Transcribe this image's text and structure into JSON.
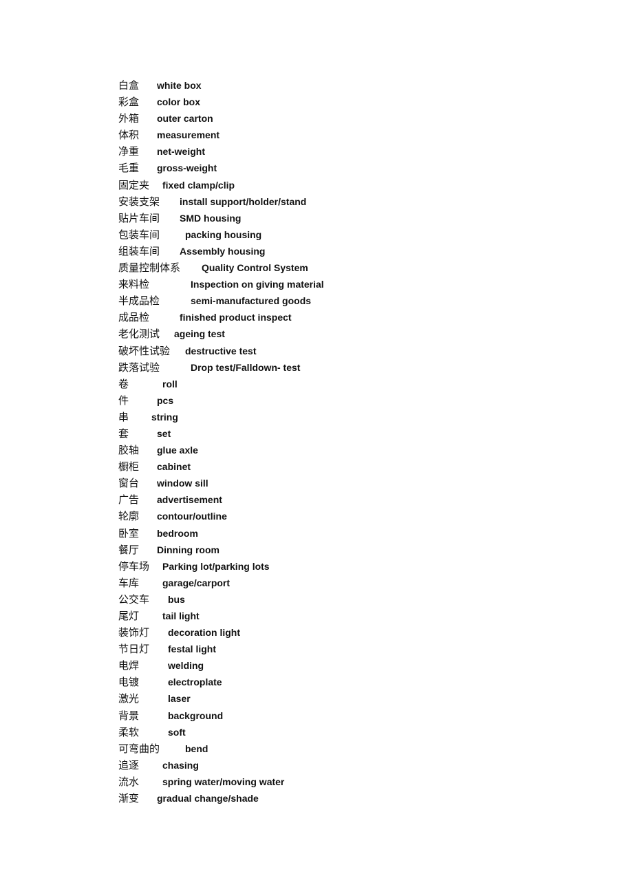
{
  "document": {
    "entries": [
      {
        "zh": "白盒",
        "en": "white box",
        "indent": 56
      },
      {
        "zh": "彩盒",
        "en": "color box",
        "indent": 56
      },
      {
        "zh": "外箱",
        "en": "outer carton",
        "indent": 56
      },
      {
        "zh": "体积",
        "en": "measurement",
        "indent": 56
      },
      {
        "zh": "净重",
        "en": "net-weight",
        "indent": 56
      },
      {
        "zh": "毛重",
        "en": "gross-weight",
        "indent": 56
      },
      {
        "zh": "固定夹",
        "en": "fixed clamp/clip",
        "indent": 64
      },
      {
        "zh": "安装支架",
        "en": "install support/holder/stand",
        "indent": 89
      },
      {
        "zh": "贴片车间",
        "en": "SMD housing",
        "indent": 89
      },
      {
        "zh": "包装车间",
        "en": "packing housing",
        "indent": 97
      },
      {
        "zh": "组装车间",
        "en": "Assembly housing",
        "indent": 89
      },
      {
        "zh": "质量控制体系",
        "en": "Quality Control System",
        "indent": 121
      },
      {
        "zh": "来料检",
        "en": "Inspection on giving material",
        "indent": 105
      },
      {
        "zh": "半成品检",
        "en": "semi-manufactured goods",
        "indent": 105
      },
      {
        "zh": "成品检",
        "en": "finished product inspect",
        "indent": 89
      },
      {
        "zh": "老化测试",
        "en": "ageing test",
        "indent": 81
      },
      {
        "zh": "破坏性试验",
        "en": "destructive test",
        "indent": 97
      },
      {
        "zh": "跌落试验",
        "en": "Drop test/Falldown- test",
        "indent": 105
      },
      {
        "zh": "卷",
        "en": "roll",
        "indent": 64
      },
      {
        "zh": "件",
        "en": "pcs",
        "indent": 56
      },
      {
        "zh": "串",
        "en": "string",
        "indent": 48
      },
      {
        "zh": "套",
        "en": "set",
        "indent": 56
      },
      {
        "zh": "胶轴",
        "en": "glue axle",
        "indent": 56
      },
      {
        "zh": "橱柜",
        "en": "cabinet",
        "indent": 56
      },
      {
        "zh": "窗台",
        "en": "window sill",
        "indent": 56
      },
      {
        "zh": "广告",
        "en": "advertisement",
        "indent": 56
      },
      {
        "zh": "轮廓",
        "en": "contour/outline",
        "indent": 56
      },
      {
        "zh": "卧室",
        "en": "bedroom",
        "indent": 56
      },
      {
        "zh": "餐厅",
        "en": "Dinning room",
        "indent": 56
      },
      {
        "zh": "停车场",
        "en": "Parking lot/parking lots",
        "indent": 64
      },
      {
        "zh": "车库",
        "en": "garage/carport",
        "indent": 64
      },
      {
        "zh": "公交车",
        "en": "bus",
        "indent": 72
      },
      {
        "zh": "尾灯",
        "en": "tail light",
        "indent": 64
      },
      {
        "zh": "装饰灯",
        "en": "decoration light",
        "indent": 72
      },
      {
        "zh": "节日灯",
        "en": "festal light",
        "indent": 72
      },
      {
        "zh": "电焊",
        "en": "welding",
        "indent": 72
      },
      {
        "zh": "电镀",
        "en": "electroplate",
        "indent": 72
      },
      {
        "zh": "激光",
        "en": "laser",
        "indent": 72
      },
      {
        "zh": "背景",
        "en": "background",
        "indent": 72
      },
      {
        "zh": "柔软",
        "en": "soft",
        "indent": 72
      },
      {
        "zh": "可弯曲的",
        "en": "bend",
        "indent": 97
      },
      {
        "zh": "追逐",
        "en": "chasing",
        "indent": 64
      },
      {
        "zh": "流水",
        "en": "spring water/moving water",
        "indent": 64
      },
      {
        "zh": "渐变",
        "en": "gradual change/shade",
        "indent": 56
      }
    ]
  }
}
